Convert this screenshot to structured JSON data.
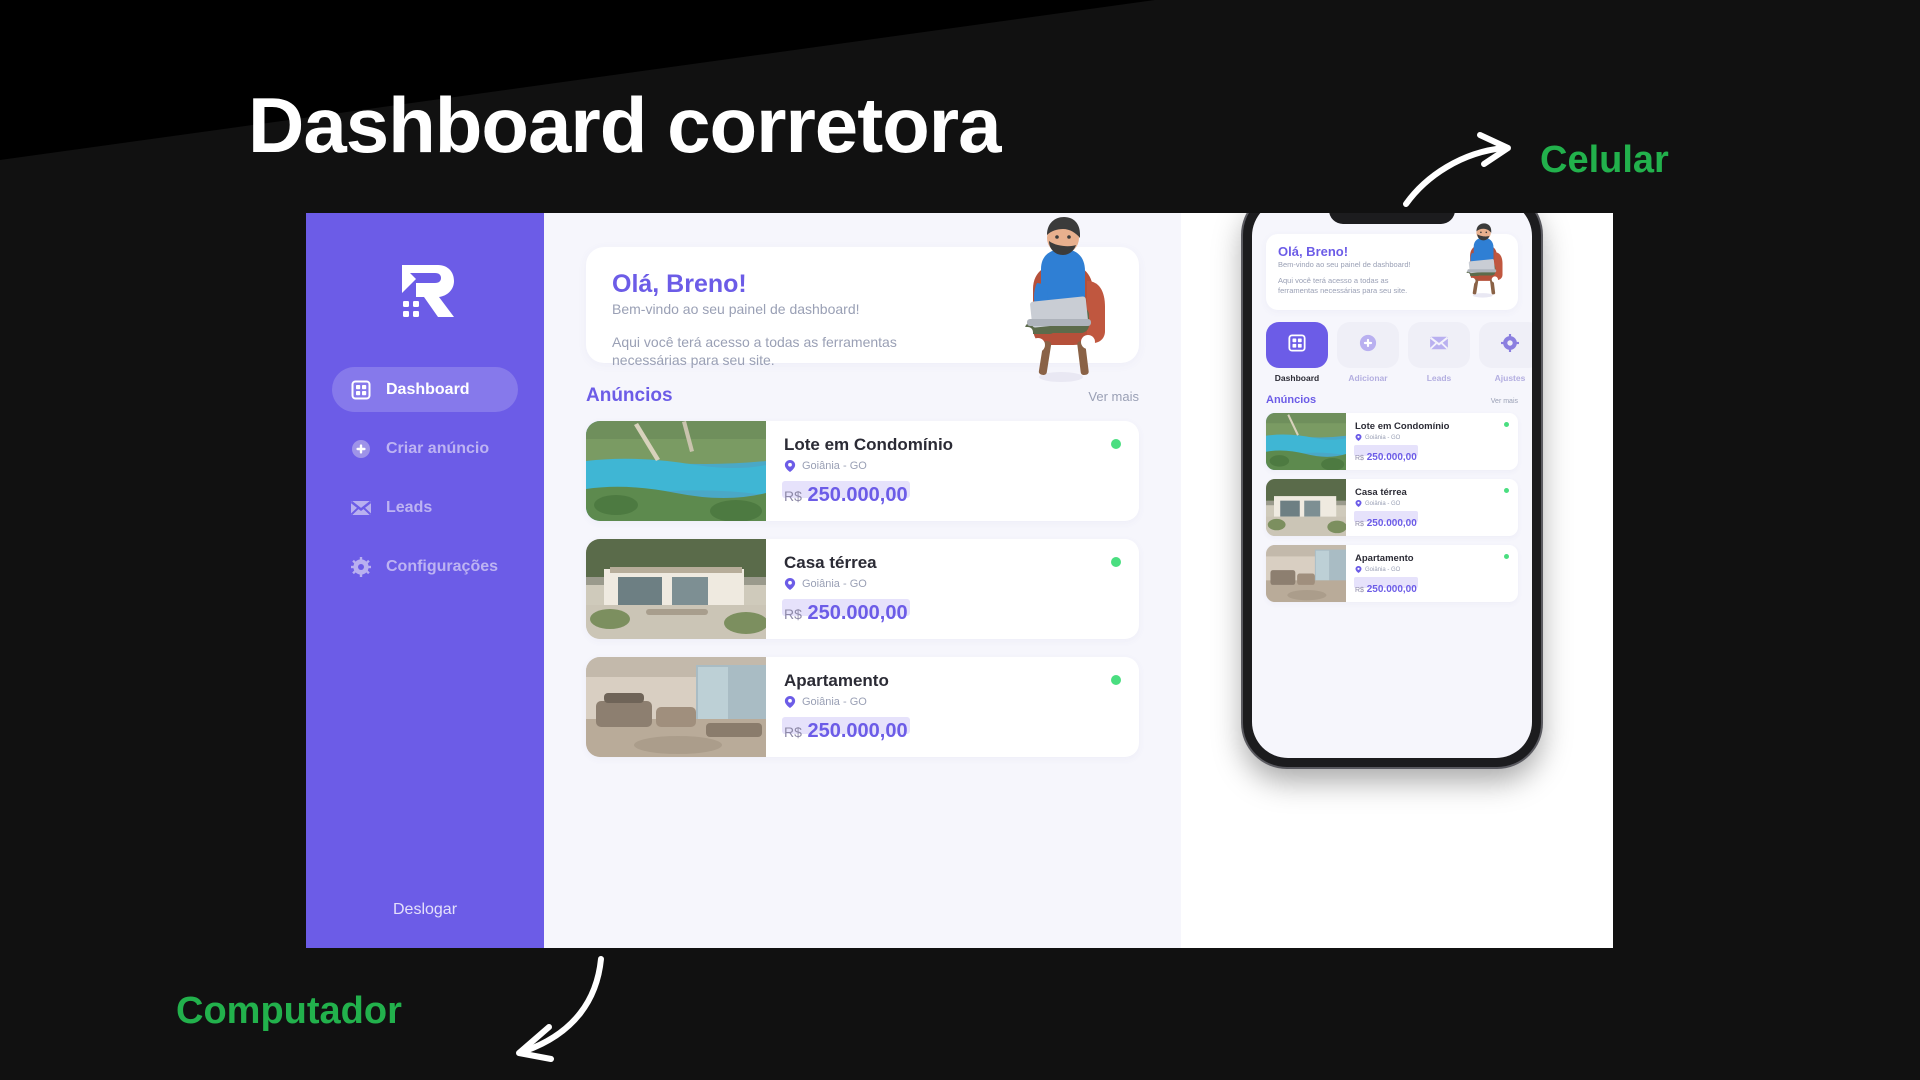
{
  "page": {
    "title": "Dashboard corretora",
    "accent_purple": "#6c5ce7",
    "annotation_green": "#22b14c",
    "background": "#111111"
  },
  "annotations": {
    "phone_label": "Celular",
    "desktop_label": "Computador"
  },
  "desktop": {
    "sidebar": {
      "logo_alt": "R logo",
      "items": [
        {
          "label": "Dashboard",
          "icon": "grid-icon",
          "active": true
        },
        {
          "label": "Criar anúncio",
          "icon": "plus-circle-icon",
          "active": false
        },
        {
          "label": "Leads",
          "icon": "envelope-icon",
          "active": false
        },
        {
          "label": "Configurações",
          "icon": "gear-icon",
          "active": false
        }
      ],
      "logout_label": "Deslogar"
    },
    "welcome": {
      "greeting": "Olá, Breno!",
      "subtitle": "Bem-vindo ao seu painel de dashboard!",
      "description": "Aqui você terá acesso a todas as ferramentas necessárias para seu site."
    },
    "listings_section": {
      "title": "Anúncios",
      "see_more": "Ver mais"
    },
    "listings": [
      {
        "title": "Lote em Condomínio",
        "location": "Goiânia - GO",
        "currency": "R$",
        "price": "250.000,00",
        "status_color": "#4ade80",
        "thumb": "aerial-lake-land"
      },
      {
        "title": "Casa térrea",
        "location": "Goiânia - GO",
        "currency": "R$",
        "price": "250.000,00",
        "status_color": "#4ade80",
        "thumb": "modern-house-exterior"
      },
      {
        "title": "Apartamento",
        "location": "Goiânia - GO",
        "currency": "R$",
        "price": "250.000,00",
        "status_color": "#4ade80",
        "thumb": "apartment-living-room"
      }
    ]
  },
  "mobile": {
    "welcome": {
      "greeting": "Olá, Breno!",
      "subtitle": "Bem-vindo ao seu painel de dashboard!",
      "description": "Aqui você terá acesso a todas as ferramentas necessárias para seu site."
    },
    "nav": [
      {
        "label": "Dashboard",
        "icon": "grid-icon",
        "active": true
      },
      {
        "label": "Adicionar",
        "icon": "plus-circle-icon",
        "active": false
      },
      {
        "label": "Leads",
        "icon": "envelope-icon",
        "active": false
      },
      {
        "label": "Ajustes",
        "icon": "gear-icon",
        "active": false
      }
    ],
    "listings_section": {
      "title": "Anúncios",
      "see_more": "Ver mais"
    },
    "listings": [
      {
        "title": "Lote em Condomínio",
        "location": "Goiânia - GO",
        "currency": "R$",
        "price": "250.000,00",
        "status_color": "#4ade80",
        "thumb": "aerial-lake-land"
      },
      {
        "title": "Casa térrea",
        "location": "Goiânia - GO",
        "currency": "R$",
        "price": "250.000,00",
        "status_color": "#4ade80",
        "thumb": "modern-house-exterior"
      },
      {
        "title": "Apartamento",
        "location": "Goiânia - GO",
        "currency": "R$",
        "price": "250.000,00",
        "status_color": "#4ade80",
        "thumb": "apartment-living-room"
      }
    ]
  }
}
